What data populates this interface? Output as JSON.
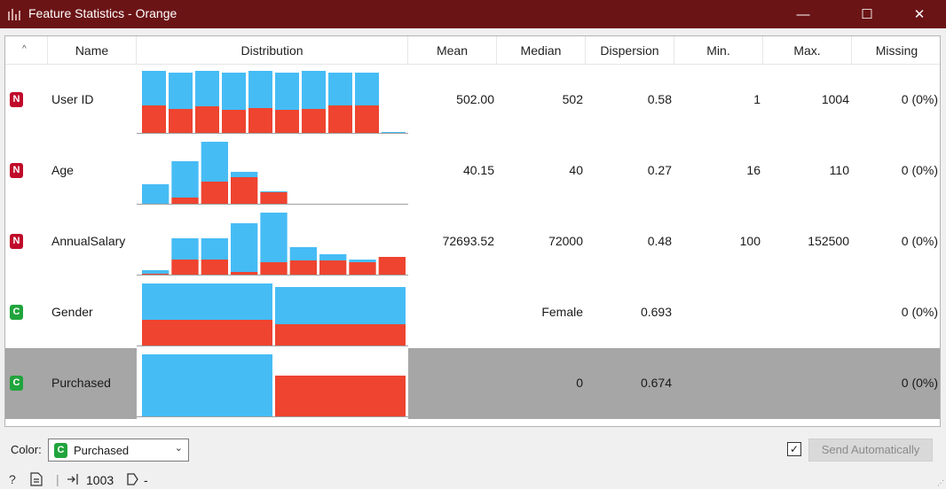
{
  "window": {
    "title": "Feature Statistics - Orange",
    "minimize": "—",
    "maximize": "☐",
    "close": "✕"
  },
  "table": {
    "sort_indicator": "^",
    "columns": [
      "",
      "Name",
      "Distribution",
      "Mean",
      "Median",
      "Dispersion",
      "Min.",
      "Max.",
      "Missing"
    ],
    "rows": [
      {
        "type": "N",
        "name": "User ID",
        "mean": "502.00",
        "median": "502",
        "dispersion": "0.58",
        "min": "1",
        "max": "1004",
        "missing": "0 (0%)"
      },
      {
        "type": "N",
        "name": "Age",
        "mean": "40.15",
        "median": "40",
        "dispersion": "0.27",
        "min": "16",
        "max": "110",
        "missing": "0 (0%)"
      },
      {
        "type": "N",
        "name": "AnnualSalary",
        "mean": "72693.52",
        "median": "72000",
        "dispersion": "0.48",
        "min": "100",
        "max": "152500",
        "missing": "0 (0%)"
      },
      {
        "type": "C",
        "name": "Gender",
        "mean": "",
        "median": "Female",
        "dispersion": "0.693",
        "min": "",
        "max": "",
        "missing": "0 (0%)"
      },
      {
        "type": "C",
        "name": "Purchased",
        "mean": "",
        "median": "0",
        "dispersion": "0.674",
        "min": "",
        "max": "",
        "missing": "0 (0%)",
        "selected": true
      }
    ]
  },
  "distributions": {
    "colors": {
      "class_0": "#46bcf5",
      "class_1": "#ee4430"
    },
    "user_id": {
      "bars": [
        [
          70,
          31
        ],
        [
          68,
          27
        ],
        [
          70,
          30
        ],
        [
          68,
          26
        ],
        [
          70,
          28
        ],
        [
          68,
          26
        ],
        [
          70,
          27
        ],
        [
          68,
          31
        ],
        [
          68,
          31
        ],
        [
          1,
          0
        ]
      ]
    },
    "age": {
      "bars": [
        [
          22,
          0
        ],
        [
          48,
          7
        ],
        [
          70,
          25
        ],
        [
          36,
          30
        ],
        [
          14,
          13
        ],
        [
          0,
          0
        ],
        [
          0,
          0
        ],
        [
          0,
          0
        ],
        [
          0,
          0
        ]
      ]
    },
    "annual_salary": {
      "bars": [
        [
          5,
          1
        ],
        [
          41,
          17
        ],
        [
          41,
          17
        ],
        [
          58,
          3
        ],
        [
          70,
          14
        ],
        [
          31,
          16
        ],
        [
          23,
          16
        ],
        [
          17,
          14
        ],
        [
          20,
          20
        ]
      ]
    },
    "gender": {
      "bars": [
        [
          70,
          29
        ],
        [
          66,
          24
        ]
      ]
    },
    "purchased": {
      "bars": [
        [
          70,
          0
        ],
        [
          46,
          46
        ]
      ]
    }
  },
  "footer": {
    "color_label": "Color:",
    "color_value": "Purchased",
    "color_badge": "C",
    "send_checked": "✓",
    "send_label": "Send Automatically"
  },
  "status": {
    "input_count": "1003",
    "output": "-"
  }
}
